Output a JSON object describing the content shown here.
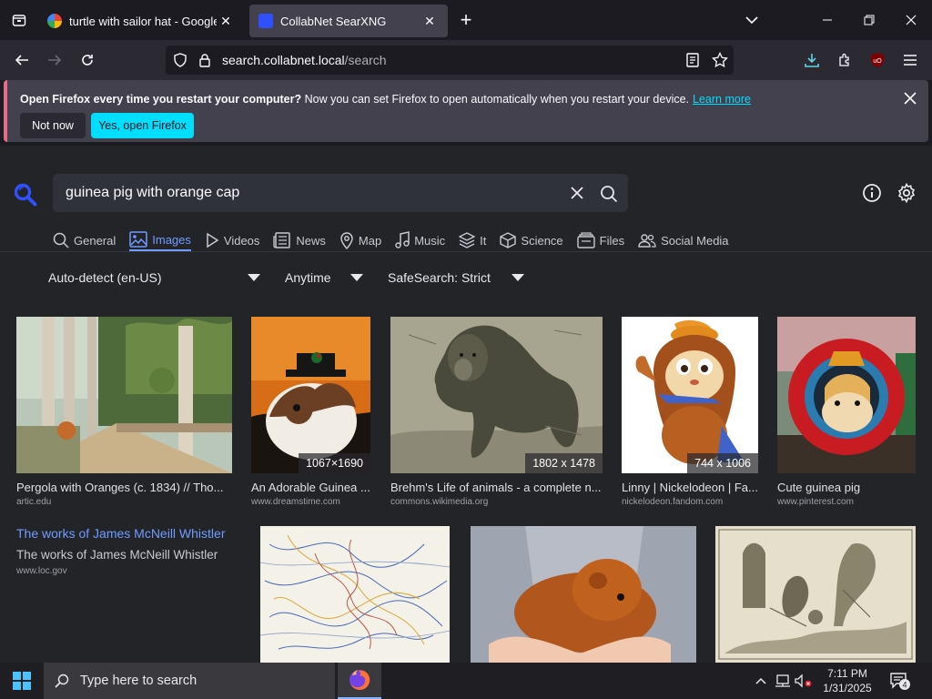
{
  "tabs": [
    {
      "title": "turtle with sailor hat - Google Se",
      "favicon": "google-icon",
      "active": false
    },
    {
      "title": "CollabNet SearXNG",
      "favicon": "searxng-icon",
      "active": true
    }
  ],
  "navbar": {
    "url_domain": "search.collabnet.local",
    "url_path": "/search"
  },
  "notification": {
    "bold_text": "Open Firefox every time you restart your computer?",
    "text": " Now you can set Firefox to open automatically when you restart your device.",
    "link": "Learn more",
    "not_now_label": "Not now",
    "yes_label": "Yes, open Firefox"
  },
  "search": {
    "query": "guinea pig with orange cap"
  },
  "categories": [
    {
      "label": "General",
      "icon": "search-icon",
      "active": false
    },
    {
      "label": "Images",
      "icon": "image-icon",
      "active": true
    },
    {
      "label": "Videos",
      "icon": "play-icon",
      "active": false
    },
    {
      "label": "News",
      "icon": "newspaper-icon",
      "active": false
    },
    {
      "label": "Map",
      "icon": "map-pin-icon",
      "active": false
    },
    {
      "label": "Music",
      "icon": "music-note-icon",
      "active": false
    },
    {
      "label": "It",
      "icon": "layers-icon",
      "active": false
    },
    {
      "label": "Science",
      "icon": "cube-icon",
      "active": false
    },
    {
      "label": "Files",
      "icon": "files-icon",
      "active": false
    },
    {
      "label": "Social Media",
      "icon": "people-icon",
      "active": false
    }
  ],
  "filters": {
    "language": "Auto-detect (en-US)",
    "time": "Anytime",
    "safesearch": "SafeSearch: Strict"
  },
  "results": [
    {
      "title": "Pergola with Oranges (c. 1834) // Tho...",
      "source": "artic.edu",
      "dims": ""
    },
    {
      "title": "An Adorable Guinea ...",
      "source": "www.dreamstime.com",
      "dims": "1067×1690"
    },
    {
      "title": "Brehm's Life of animals - a complete n...",
      "source": "commons.wikimedia.org",
      "dims": "1802 x 1478"
    },
    {
      "title": "Linny | Nickelodeon | Fa...",
      "source": "nickelodeon.fandom.com",
      "dims": "744 x 1006"
    },
    {
      "title": "Cute guinea pig",
      "source": "www.pinterest.com",
      "dims": ""
    }
  ],
  "web_result": {
    "link": "The works of James McNeill Whistler",
    "subtitle": "The works of James McNeill Whistler",
    "source": "www.loc.gov"
  },
  "taskbar": {
    "search_placeholder": "Type here to search",
    "time": "7:11 PM",
    "date": "1/31/2025",
    "notification_count": "4"
  }
}
